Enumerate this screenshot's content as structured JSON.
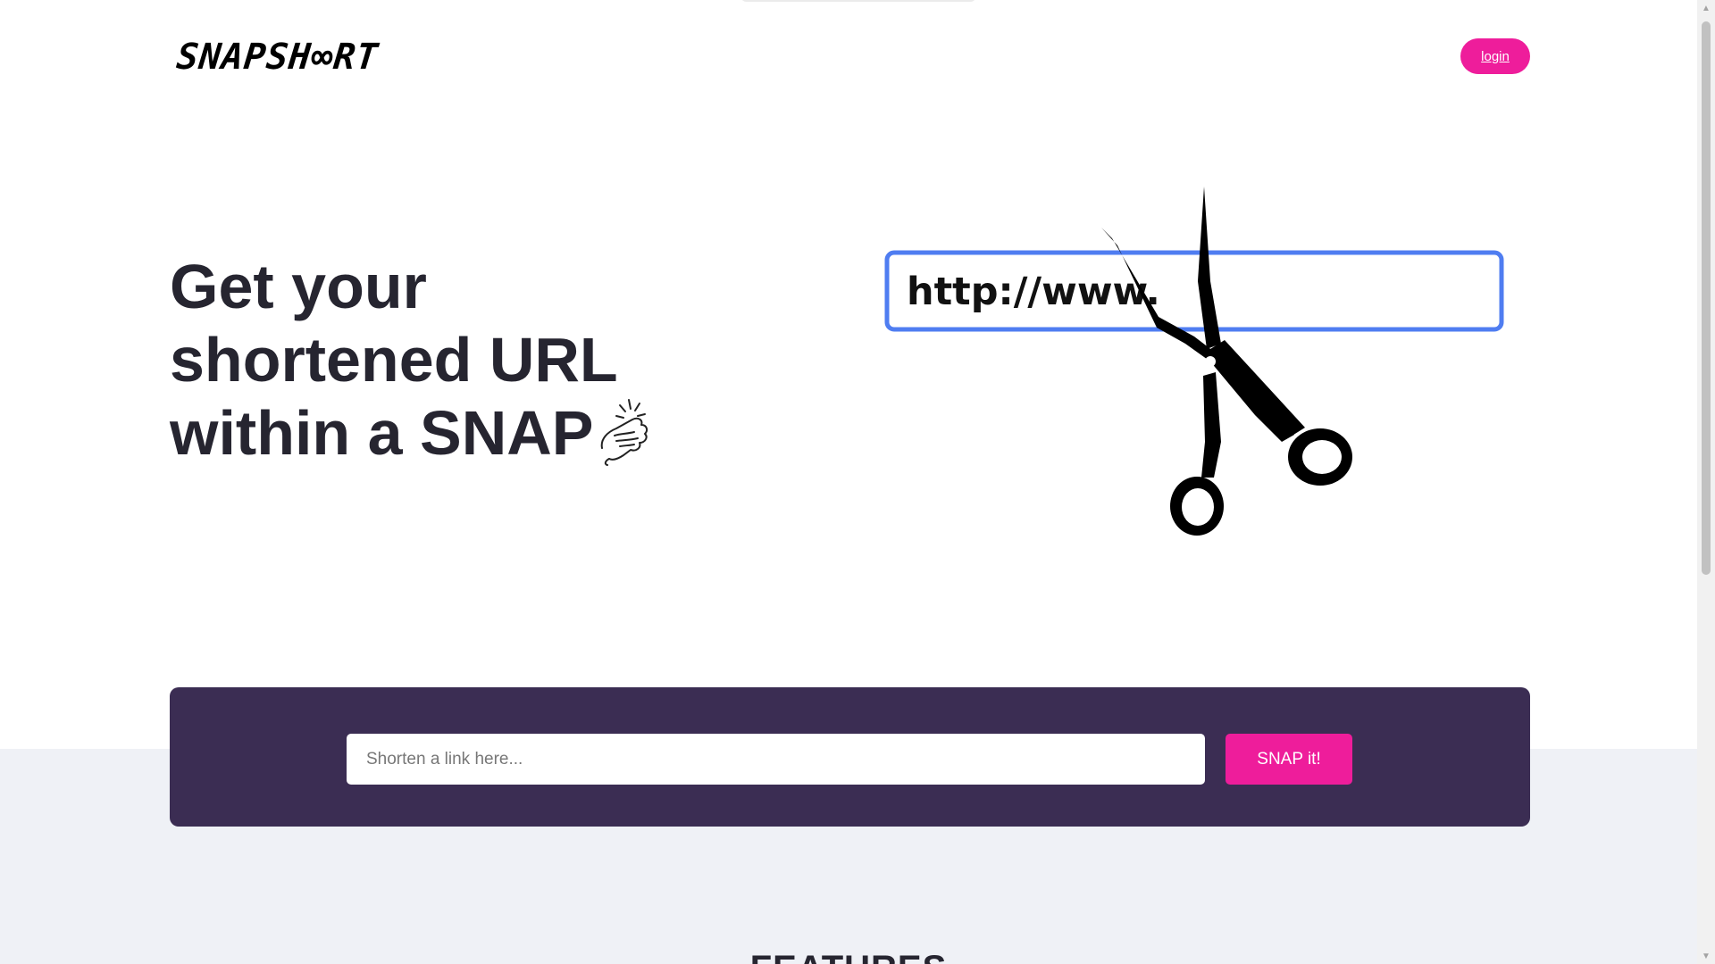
{
  "header": {
    "logo_text": "SNAPSH∞RT",
    "login_label": "login"
  },
  "hero": {
    "title_lines": [
      "Get your",
      "shortened URL",
      "within a SNAP"
    ],
    "illustration_url_text": "http://www."
  },
  "shortener": {
    "input_placeholder": "Shorten a link here...",
    "input_value": "",
    "submit_label": "SNAP it!"
  },
  "features": {
    "title": "FEATURES"
  },
  "icons": {
    "snap_hand": "snapping-fingers-icon",
    "scissors": "scissors-icon"
  },
  "colors": {
    "accent_pink": "#ee1d9b",
    "panel_purple": "#3b2d53",
    "band_gray": "#eff1f6",
    "url_box_border": "#4f7df1",
    "text_dark": "#262530"
  }
}
